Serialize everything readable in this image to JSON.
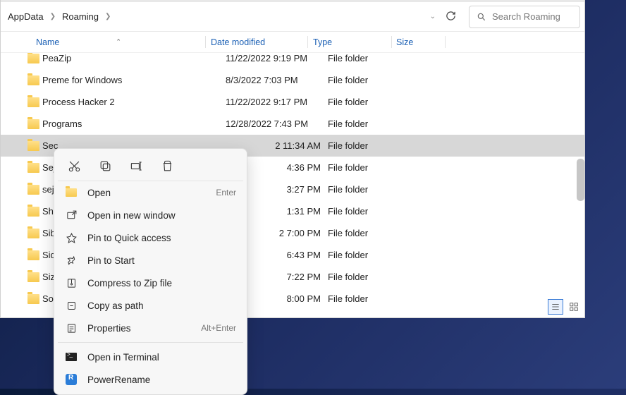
{
  "breadcrumb": {
    "seg1": "AppData",
    "seg2": "Roaming"
  },
  "search": {
    "placeholder": "Search Roaming"
  },
  "columns": {
    "name": "Name",
    "date": "Date modified",
    "type": "Type",
    "size": "Size"
  },
  "rows": [
    {
      "name": "PeaZip",
      "date": "11/22/2022 9:19 PM",
      "type": "File folder",
      "size": ""
    },
    {
      "name": "Preme for Windows",
      "date": "8/3/2022 7:03 PM",
      "type": "File folder",
      "size": ""
    },
    {
      "name": "Process Hacker 2",
      "date": "11/22/2022 9:17 PM",
      "type": "File folder",
      "size": ""
    },
    {
      "name": "Programs",
      "date": "12/28/2022 7:43 PM",
      "type": "File folder",
      "size": ""
    },
    {
      "name": "Sec",
      "date": "2 11:34 AM",
      "type": "File folder",
      "size": ""
    },
    {
      "name": "Sej",
      "date": "4:36 PM",
      "type": "File folder",
      "size": ""
    },
    {
      "name": "sej",
      "date": "3:27 PM",
      "type": "File folder",
      "size": ""
    },
    {
      "name": "Sh",
      "date": "1:31 PM",
      "type": "File folder",
      "size": ""
    },
    {
      "name": "Sib",
      "date": "2 7:00 PM",
      "type": "File folder",
      "size": ""
    },
    {
      "name": "Sid",
      "date": "6:43 PM",
      "type": "File folder",
      "size": ""
    },
    {
      "name": "Siz",
      "date": "7:22 PM",
      "type": "File folder",
      "size": ""
    },
    {
      "name": "So",
      "date": "8:00 PM",
      "type": "File folder",
      "size": ""
    }
  ],
  "context": {
    "open": {
      "label": "Open",
      "shortcut": "Enter"
    },
    "new_window": {
      "label": "Open in new window"
    },
    "pin_quick": {
      "label": "Pin to Quick access"
    },
    "pin_start": {
      "label": "Pin to Start"
    },
    "zip": {
      "label": "Compress to Zip file"
    },
    "copy_path": {
      "label": "Copy as path"
    },
    "properties": {
      "label": "Properties",
      "shortcut": "Alt+Enter"
    },
    "terminal": {
      "label": "Open in Terminal"
    },
    "powerrename": {
      "label": "PowerRename"
    }
  }
}
